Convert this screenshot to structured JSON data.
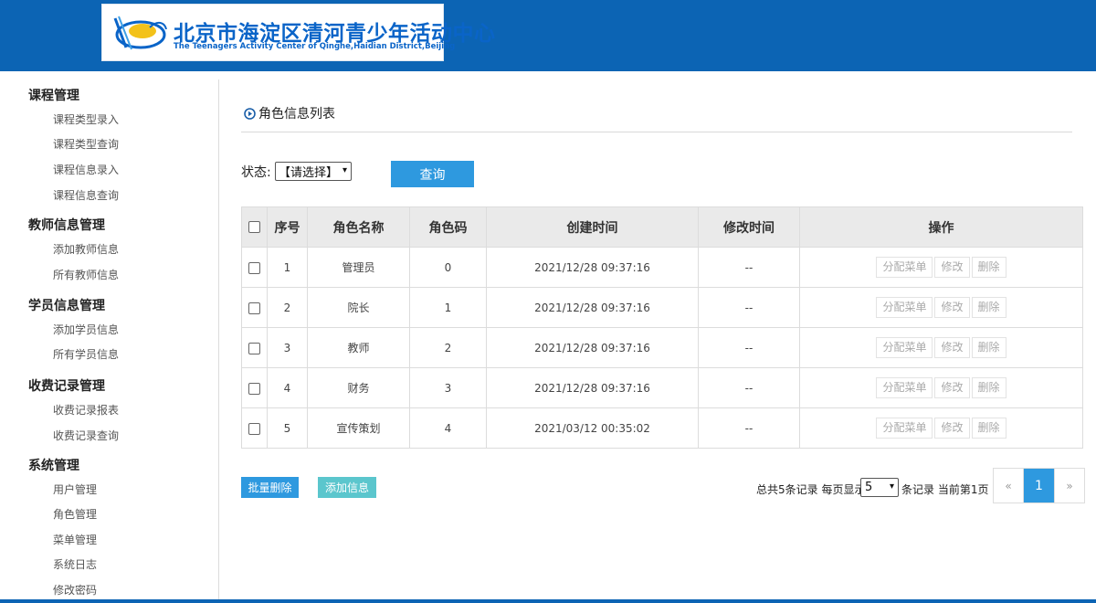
{
  "header": {
    "org_name_cn": "北京市海淀区清河青少年活动中心",
    "org_name_en": "The Teenagers Activity Center of Qinghe,Haidian District,Beijing"
  },
  "sidebar": {
    "sections": [
      {
        "title": "课程管理",
        "items": [
          "课程类型录入",
          "课程类型查询",
          "课程信息录入",
          "课程信息查询"
        ]
      },
      {
        "title": "教师信息管理",
        "items": [
          "添加教师信息",
          "所有教师信息"
        ]
      },
      {
        "title": "学员信息管理",
        "items": [
          "添加学员信息",
          "所有学员信息"
        ]
      },
      {
        "title": "收费记录管理",
        "items": [
          "收费记录报表",
          "收费记录查询"
        ]
      },
      {
        "title": "系统管理",
        "items": [
          "用户管理",
          "角色管理",
          "菜单管理",
          "系统日志",
          "修改密码"
        ]
      }
    ]
  },
  "main": {
    "page_title": "角色信息列表",
    "filter": {
      "label": "状态:",
      "select_value": "【请选择】",
      "query_button": "查询"
    },
    "table": {
      "headers": [
        "序号",
        "角色名称",
        "角色码",
        "创建时间",
        "修改时间",
        "操作"
      ],
      "rows": [
        {
          "no": "1",
          "name": "管理员",
          "code": "0",
          "created": "2021/12/28 09:37:16",
          "modified": "--"
        },
        {
          "no": "2",
          "name": "院长",
          "code": "1",
          "created": "2021/12/28 09:37:16",
          "modified": "--"
        },
        {
          "no": "3",
          "name": "教师",
          "code": "2",
          "created": "2021/12/28 09:37:16",
          "modified": "--"
        },
        {
          "no": "4",
          "name": "财务",
          "code": "3",
          "created": "2021/12/28 09:37:16",
          "modified": "--"
        },
        {
          "no": "5",
          "name": "宣传策划",
          "code": "4",
          "created": "2021/03/12 00:35:02",
          "modified": "--"
        }
      ],
      "actions": [
        "分配菜单",
        "修改",
        "删除"
      ]
    },
    "batch_delete": "批量删除",
    "add_info": "添加信息",
    "pagination": {
      "total_text": "总共5条记录  每页显示",
      "page_size": "5",
      "after_text": "条记录  当前第1页",
      "prev": "«",
      "current": "1",
      "next": "»"
    }
  }
}
